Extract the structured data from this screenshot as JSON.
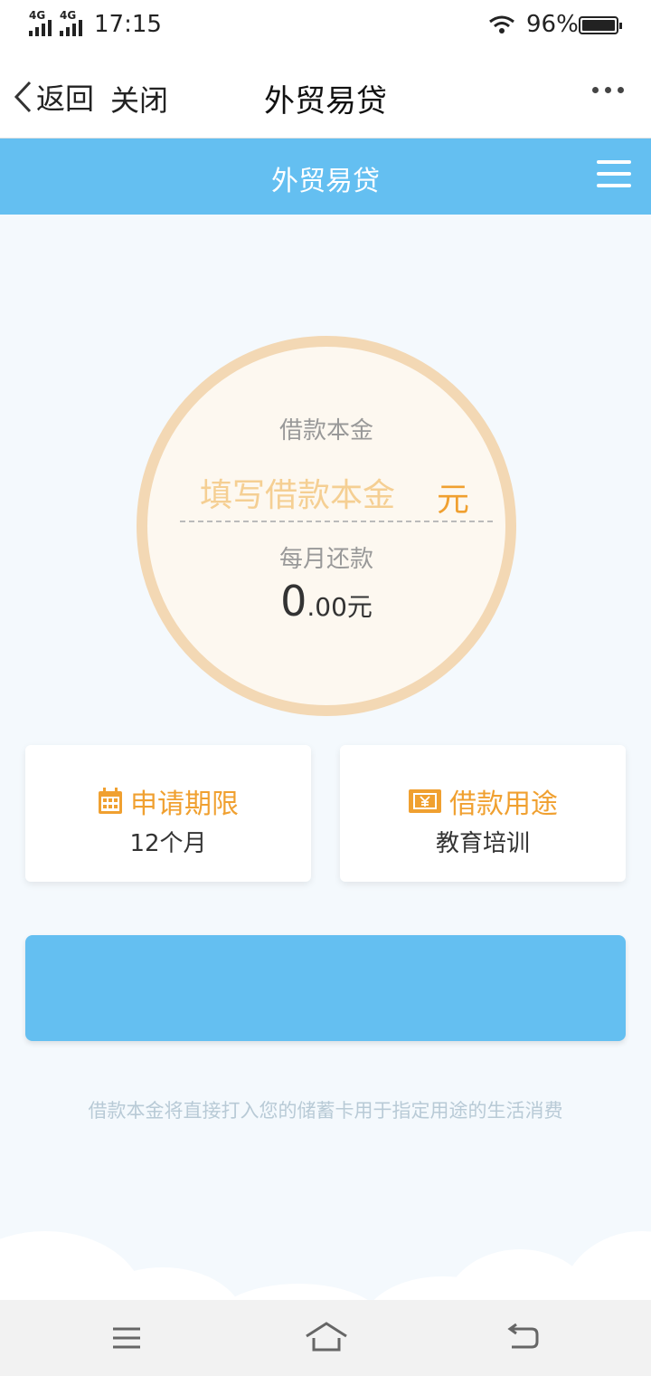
{
  "status_bar": {
    "network_labels": [
      "4G",
      "4G"
    ],
    "time": "17:15",
    "battery_percent": "96%"
  },
  "nav_bar": {
    "back_label": "返回",
    "close_label": "关闭",
    "title": "外贸易贷"
  },
  "app_header": {
    "title": "外贸易贷"
  },
  "calculator": {
    "principal_label": "借款本金",
    "principal_placeholder": "填写借款本金",
    "principal_value": "",
    "principal_unit": "元",
    "monthly_label": "每月还款",
    "monthly_integer": "0",
    "monthly_fraction": ".00元"
  },
  "cards": {
    "term": {
      "label": "申请期限",
      "value": "12个月",
      "icon": "calendar-icon"
    },
    "purpose": {
      "label": "借款用途",
      "value": "教育培训",
      "icon": "yuan-ticket-icon"
    }
  },
  "submit_button": {
    "label": ""
  },
  "note": "借款本金将直接打入您的储蓄卡用于指定用途的生活消费",
  "colors": {
    "primary": "#64bff1",
    "accent": "#f0a030",
    "circle_border": "#f3d8b4",
    "placeholder": "#f5cf93"
  }
}
